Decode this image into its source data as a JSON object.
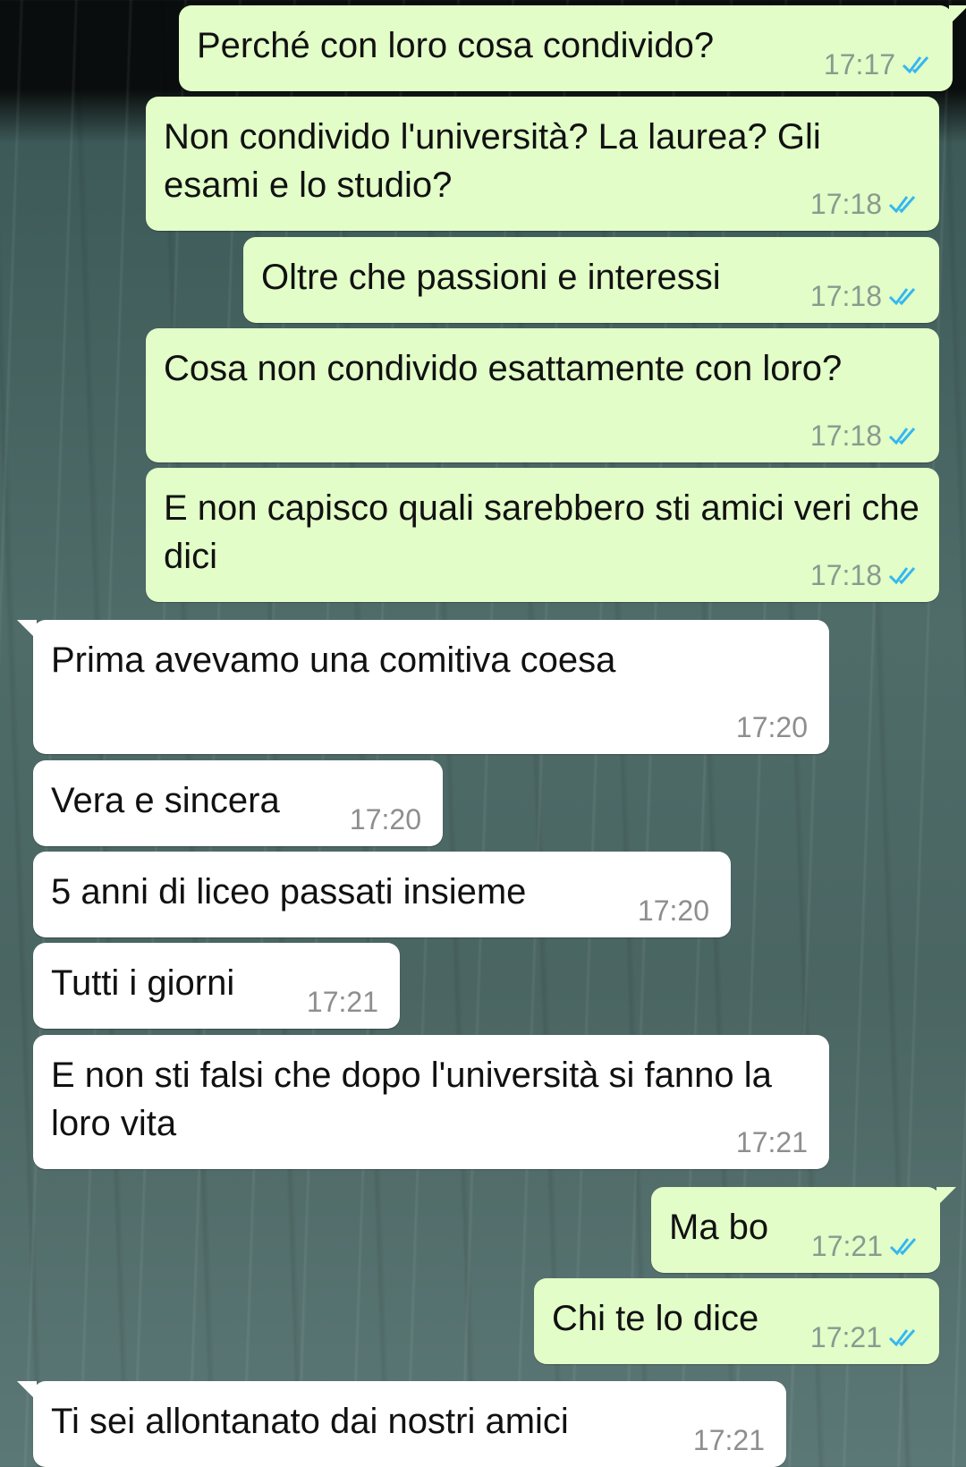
{
  "chat": {
    "messages": [
      {
        "dir": "out",
        "text": "Perché con loro cosa condivido?",
        "time": "17:17",
        "status": "read"
      },
      {
        "dir": "out",
        "text": "Non condivido l'università? La laurea? Gli esami e lo studio?",
        "time": "17:18",
        "status": "read"
      },
      {
        "dir": "out",
        "text": "Oltre che passioni e interessi",
        "time": "17:18",
        "status": "read"
      },
      {
        "dir": "out",
        "text": "Cosa non condivido esattamente con loro?",
        "time": "17:18",
        "status": "read"
      },
      {
        "dir": "out",
        "text": "E non capisco quali sarebbero sti amici veri che dici",
        "time": "17:18",
        "status": "read"
      },
      {
        "dir": "in",
        "text": "Prima avevamo una comitiva coesa",
        "time": "17:20"
      },
      {
        "dir": "in",
        "text": "Vera e sincera",
        "time": "17:20"
      },
      {
        "dir": "in",
        "text": "5 anni di liceo passati insieme",
        "time": "17:20"
      },
      {
        "dir": "in",
        "text": "Tutti i giorni",
        "time": "17:21"
      },
      {
        "dir": "in",
        "text": "E non sti falsi che dopo l'università si fanno la loro vita",
        "time": "17:21"
      },
      {
        "dir": "out",
        "text": "Ma bo",
        "time": "17:21",
        "status": "read"
      },
      {
        "dir": "out",
        "text": "Chi te lo dice",
        "time": "17:21",
        "status": "read"
      },
      {
        "dir": "in",
        "text": "Ti sei allontanato dai nostri amici",
        "time": "17:21"
      }
    ]
  },
  "colors": {
    "outgoing_bubble": "#e2fdc8",
    "incoming_bubble": "#ffffff",
    "read_ticks": "#34b7f1"
  },
  "icons": {
    "read_status": "double-check-icon"
  }
}
